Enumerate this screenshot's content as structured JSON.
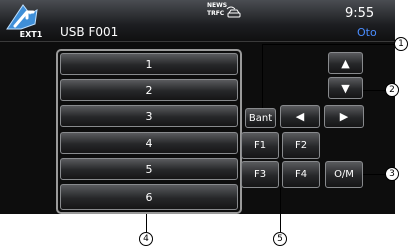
{
  "header": {
    "source_label": "EXT1",
    "title": "USB F001",
    "news_line1": "NEWS",
    "news_line2": "TRFC",
    "clock": "9:55",
    "mode": "Oto"
  },
  "presets": [
    "1",
    "2",
    "3",
    "4",
    "5",
    "6"
  ],
  "controls": {
    "band_label": "Bant",
    "up_arrow": "▲",
    "down_arrow": "▼",
    "left_arrow": "◀",
    "right_arrow": "▶",
    "f1": "F1",
    "f2": "F2",
    "f3": "F3",
    "f4": "F4",
    "om_label": "O/M"
  },
  "callouts": [
    "1",
    "2",
    "3",
    "4",
    "5"
  ],
  "icons": {
    "source": "source-arrow-icon",
    "news": "news-traffic-icon"
  }
}
